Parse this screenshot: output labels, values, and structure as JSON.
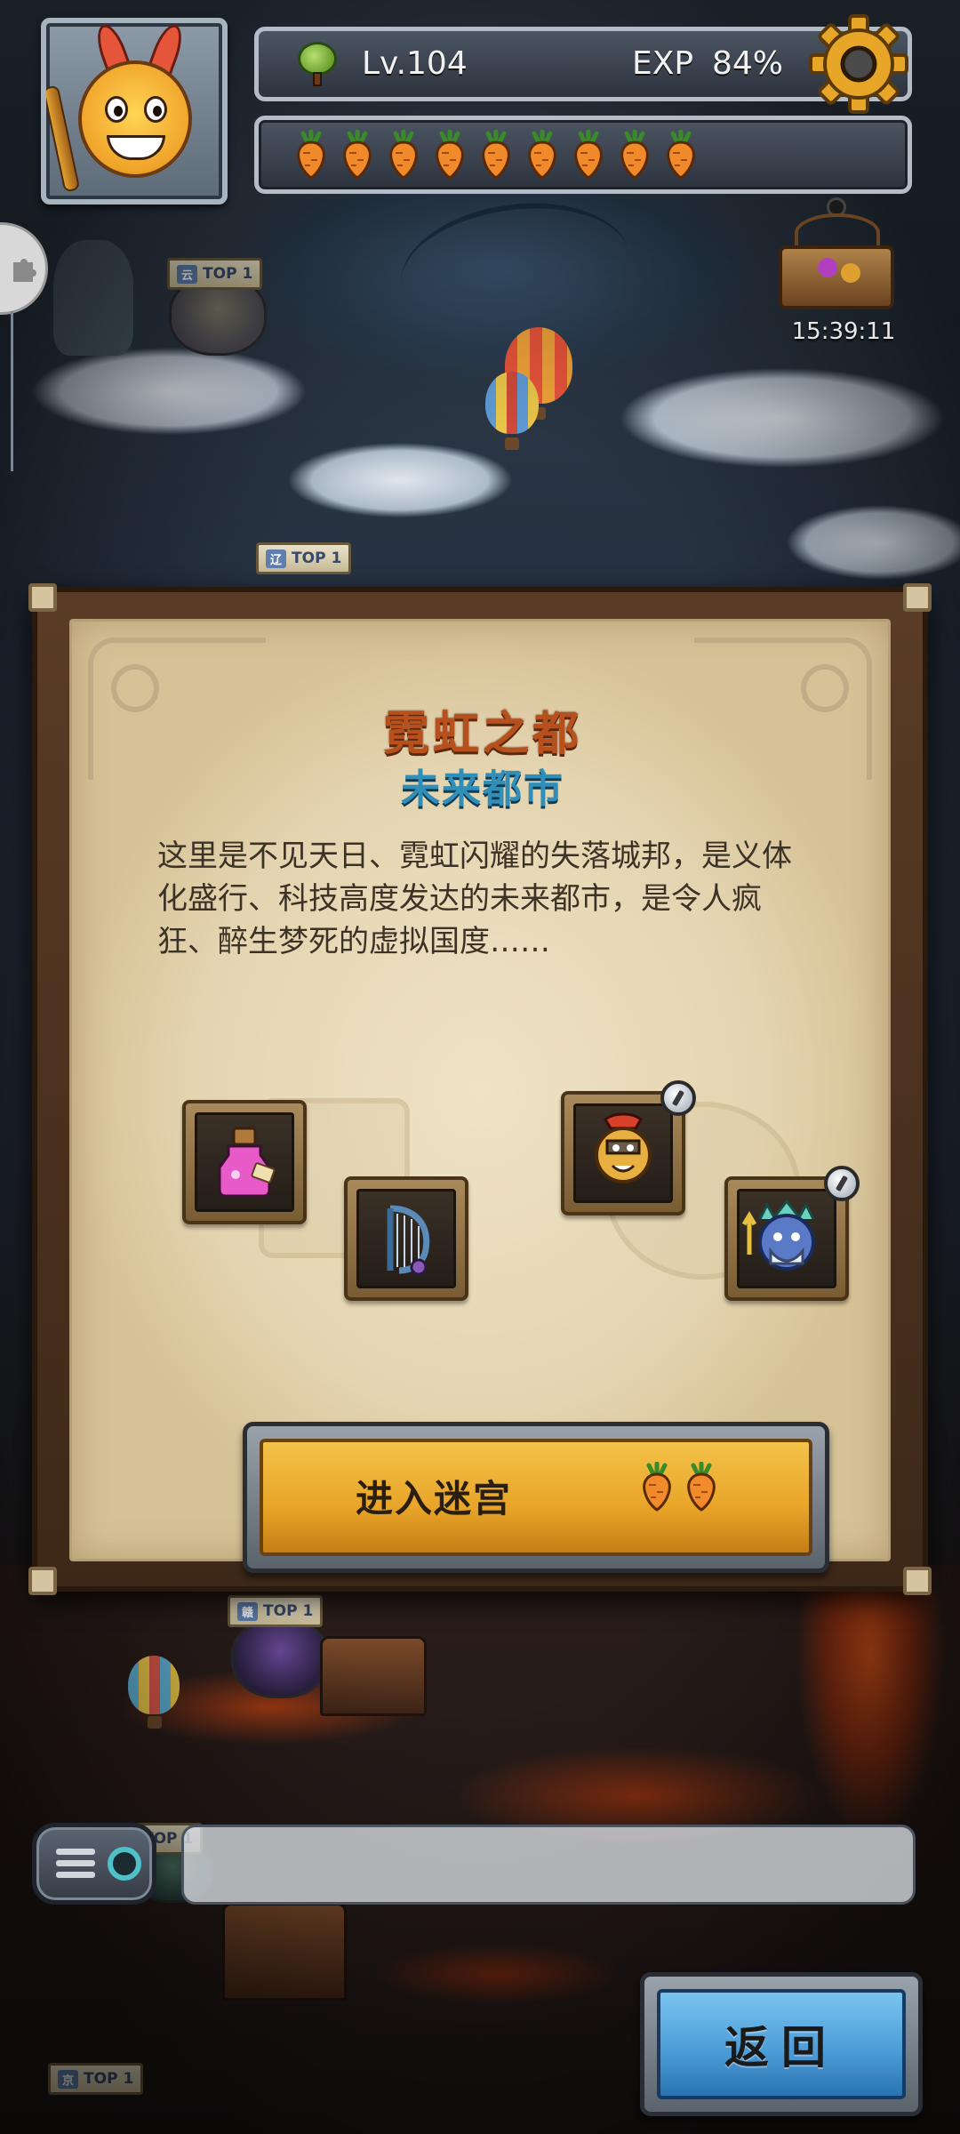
{
  "hud": {
    "level_label": "Lv.104",
    "exp_label": "EXP",
    "exp_value": "84%",
    "exp_progress": 0.84,
    "stamina_carrots": 9,
    "chest_timer": "15:39:11"
  },
  "map_badges": [
    {
      "tag": "云",
      "text": "TOP 1"
    },
    {
      "tag": "辽",
      "text": "TOP 1"
    },
    {
      "tag": "赣",
      "text": "TOP 1"
    },
    {
      "tag": "",
      "text": "TOP 1"
    },
    {
      "tag": "京",
      "text": "TOP 1"
    }
  ],
  "dialog": {
    "title": "霓虹之都",
    "subtitle": "未来都市",
    "description": "这里是不见天日、霓虹闪耀的失落城邦，是义体化盛行、科技高度发达的未来都市，是令人疯狂、醉生梦死的虚拟国度……",
    "rewards": [
      {
        "icon": "potion-bottle-icon",
        "kind": "item"
      },
      {
        "icon": "harp-icon",
        "kind": "item"
      },
      {
        "icon": "spartan-hero-icon",
        "kind": "hero"
      },
      {
        "icon": "poseidon-hero-icon",
        "kind": "hero"
      }
    ],
    "enter_button": {
      "label": "进入迷宫",
      "cost_carrots": 2
    }
  },
  "bottom": {
    "back_label": "返回",
    "chat_placeholder": ""
  },
  "colors": {
    "title": "#b8501e",
    "subtitle": "#2f8fb8",
    "enter_button": "#f0b838",
    "back_button": "#4a9ad6"
  }
}
